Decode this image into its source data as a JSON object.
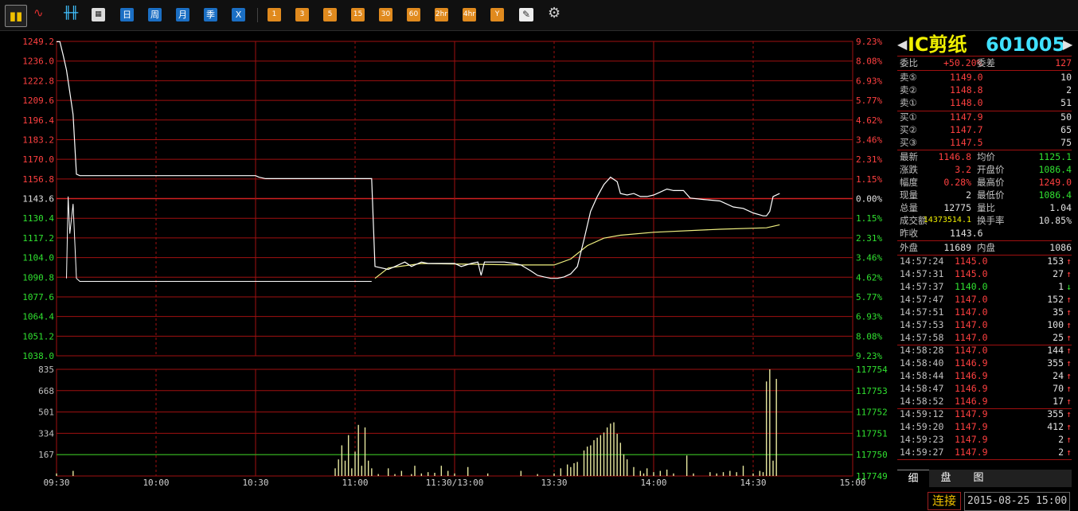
{
  "toolbar": {
    "buttons": [
      "日",
      "周",
      "月",
      "季",
      "X",
      "1",
      "3",
      "5",
      "15",
      "30",
      "60",
      "2hr",
      "4hr",
      "Y"
    ]
  },
  "stock": {
    "name": "IC剪纸",
    "code": "601005"
  },
  "order_book": {
    "weibi_label": "委比",
    "weibi_value": "+50.20%",
    "weicha_label": "委差",
    "weicha_value": "127",
    "asks": [
      {
        "label": "卖⑤",
        "price": "1149.0",
        "volume": "10"
      },
      {
        "label": "卖②",
        "price": "1148.8",
        "volume": "2"
      },
      {
        "label": "卖①",
        "price": "1148.0",
        "volume": "51"
      }
    ],
    "bids": [
      {
        "label": "买①",
        "price": "1147.9",
        "volume": "50"
      },
      {
        "label": "买②",
        "price": "1147.7",
        "volume": "65"
      },
      {
        "label": "买③",
        "price": "1147.5",
        "volume": "75"
      }
    ]
  },
  "quote": {
    "rows": [
      {
        "l1": "最新",
        "v1": "1146.8",
        "c1": "r",
        "l2": "均价",
        "v2": "1125.1",
        "c2": "g"
      },
      {
        "l1": "涨跌",
        "v1": "3.2",
        "c1": "r",
        "l2": "开盘价",
        "v2": "1086.4",
        "c2": "g"
      },
      {
        "l1": "幅度",
        "v1": "0.28%",
        "c1": "r",
        "l2": "最高价",
        "v2": "1249.0",
        "c2": "r"
      },
      {
        "l1": "现量",
        "v1": "2",
        "c1": "w",
        "l2": "最低价",
        "v2": "1086.4",
        "c2": "g"
      },
      {
        "l1": "总量",
        "v1": "12775",
        "c1": "w",
        "l2": "量比",
        "v2": "1.04",
        "c2": "w"
      },
      {
        "l1": "成交额",
        "v1": "14373514.1",
        "c1": "y",
        "l2": "换手率",
        "v2": "10.85%",
        "c2": "w"
      }
    ],
    "prev_close_label": "昨收",
    "prev_close": "1143.6",
    "outer_label": "外盘",
    "outer": "11689",
    "inner_label": "内盘",
    "inner": "1086"
  },
  "trades": [
    {
      "time": "14:57:24",
      "price": "1145.0",
      "vol": "153",
      "dir": "↑",
      "pc": "r"
    },
    {
      "time": "14:57:31",
      "price": "1145.0",
      "vol": "27",
      "dir": "↑",
      "pc": "r"
    },
    {
      "time": "14:57:37",
      "price": "1140.0",
      "vol": "1",
      "dir": "↓",
      "pc": "g"
    },
    {
      "time": "14:57:47",
      "price": "1147.0",
      "vol": "152",
      "dir": "↑",
      "pc": "r"
    },
    {
      "time": "14:57:51",
      "price": "1147.0",
      "vol": "35",
      "dir": "↑",
      "pc": "r"
    },
    {
      "time": "14:57:53",
      "price": "1147.0",
      "vol": "100",
      "dir": "↑",
      "pc": "r"
    },
    {
      "time": "14:57:58",
      "price": "1147.0",
      "vol": "25",
      "dir": "↑",
      "pc": "r"
    },
    {
      "time": "14:58:28",
      "price": "1147.0",
      "vol": "144",
      "dir": "↑",
      "pc": "r"
    },
    {
      "time": "14:58:40",
      "price": "1146.9",
      "vol": "355",
      "dir": "↑",
      "pc": "r"
    },
    {
      "time": "14:58:44",
      "price": "1146.9",
      "vol": "24",
      "dir": "↑",
      "pc": "r"
    },
    {
      "time": "14:58:47",
      "price": "1146.9",
      "vol": "70",
      "dir": "↑",
      "pc": "r"
    },
    {
      "time": "14:58:52",
      "price": "1146.9",
      "vol": "17",
      "dir": "↑",
      "pc": "r"
    },
    {
      "time": "14:59:12",
      "price": "1147.9",
      "vol": "355",
      "dir": "↑",
      "pc": "r"
    },
    {
      "time": "14:59:20",
      "price": "1147.9",
      "vol": "412",
      "dir": "↑",
      "pc": "r"
    },
    {
      "time": "14:59:23",
      "price": "1147.9",
      "vol": "2",
      "dir": "↑",
      "pc": "r"
    },
    {
      "time": "14:59:27",
      "price": "1147.9",
      "vol": "2",
      "dir": "↑",
      "pc": "r"
    }
  ],
  "tabs": [
    "细",
    "盘",
    "图"
  ],
  "status": {
    "connection": "连接",
    "datetime": "2015-08-25 15:00"
  },
  "colors": {
    "up": "#ff4040",
    "down": "#30e030",
    "grid": "#a01010",
    "price_line": "#ffffff",
    "avg_line": "#f0f080",
    "volume_ref": "#20c020"
  },
  "chart_data": {
    "type": "line",
    "prev_close": 1143.6,
    "price_ticks": [
      "1249.2",
      "1236.0",
      "1222.8",
      "1209.6",
      "1196.4",
      "1183.2",
      "1170.0",
      "1156.8",
      "1143.6",
      "1130.4",
      "1117.2",
      "1104.0",
      "1090.8",
      "1077.6",
      "1064.4",
      "1051.2",
      "1038.0"
    ],
    "pct_ticks": [
      "9.23%",
      "8.08%",
      "6.93%",
      "5.77%",
      "4.62%",
      "3.46%",
      "2.31%",
      "1.15%",
      "0.00%",
      "1.15%",
      "2.31%",
      "3.46%",
      "4.62%",
      "5.77%",
      "6.93%",
      "8.08%",
      "9.23%"
    ],
    "ylim": [
      1038.0,
      1249.2
    ],
    "time_labels": [
      "09:30",
      "10:00",
      "10:30",
      "11:00",
      "11:30/13:00",
      "13:30",
      "14:00",
      "14:30",
      "15:00"
    ],
    "volume_ticks": [
      "835",
      "668",
      "501",
      "334",
      "167"
    ],
    "volume_right_ticks": [
      "117754",
      "117753",
      "117752",
      "117751",
      "117750",
      "117749"
    ],
    "volume_ylim": [
      0,
      835
    ],
    "volume_ref": 167,
    "price_series": {
      "name": "price",
      "points": [
        [
          0,
          1249
        ],
        [
          1,
          1249
        ],
        [
          2,
          1240
        ],
        [
          3,
          1230
        ],
        [
          4,
          1215
        ],
        [
          5,
          1200
        ],
        [
          6,
          1160
        ],
        [
          7,
          1159
        ],
        [
          20,
          1159
        ],
        [
          60,
          1159
        ],
        [
          61,
          1158
        ],
        [
          63,
          1157
        ],
        [
          95,
          1157
        ],
        [
          96,
          1098
        ],
        [
          100,
          1096
        ],
        [
          103,
          1099
        ],
        [
          105,
          1101
        ],
        [
          107,
          1098
        ],
        [
          110,
          1101
        ],
        [
          112,
          1100
        ],
        [
          118,
          1100
        ],
        [
          120,
          1100
        ],
        [
          122,
          1098
        ],
        [
          125,
          1100
        ],
        [
          127,
          1101
        ],
        [
          128,
          1092
        ],
        [
          129,
          1101
        ],
        [
          132,
          1101
        ],
        [
          135,
          1101
        ],
        [
          138,
          1100
        ],
        [
          140,
          1099
        ],
        [
          143,
          1095
        ],
        [
          145,
          1092
        ],
        [
          147,
          1091
        ],
        [
          149,
          1090
        ],
        [
          151,
          1090
        ],
        [
          153,
          1091
        ],
        [
          155,
          1093
        ],
        [
          157,
          1098
        ],
        [
          159,
          1116
        ],
        [
          161,
          1135
        ],
        [
          163,
          1145
        ],
        [
          165,
          1153
        ],
        [
          167,
          1158
        ],
        [
          169,
          1155
        ],
        [
          170,
          1147
        ],
        [
          172,
          1146
        ],
        [
          174,
          1147
        ],
        [
          176,
          1145
        ],
        [
          178,
          1145
        ],
        [
          180,
          1146
        ],
        [
          182,
          1148
        ],
        [
          184,
          1150
        ],
        [
          186,
          1149
        ],
        [
          189,
          1149
        ],
        [
          191,
          1144
        ],
        [
          195,
          1143
        ],
        [
          200,
          1142
        ],
        [
          204,
          1138
        ],
        [
          207,
          1137
        ],
        [
          210,
          1134
        ],
        [
          213,
          1132
        ],
        [
          214,
          1132
        ],
        [
          215,
          1135
        ],
        [
          216,
          1145
        ],
        [
          218,
          1147
        ]
      ]
    },
    "avg_series": {
      "name": "avg",
      "points": [
        [
          96,
          1090
        ],
        [
          100,
          1097
        ],
        [
          110,
          1100
        ],
        [
          140,
          1099
        ],
        [
          150,
          1099
        ],
        [
          155,
          1103
        ],
        [
          160,
          1112
        ],
        [
          165,
          1117
        ],
        [
          170,
          1119
        ],
        [
          180,
          1121
        ],
        [
          200,
          1123
        ],
        [
          214,
          1124
        ],
        [
          218,
          1126
        ]
      ]
    },
    "low_series": {
      "points": [
        [
          3,
          1090
        ],
        [
          3.5,
          1145
        ],
        [
          4,
          1120
        ],
        [
          5,
          1140
        ],
        [
          6,
          1090
        ],
        [
          7,
          1088
        ],
        [
          20,
          1088
        ],
        [
          60,
          1088
        ],
        [
          95,
          1088
        ]
      ]
    },
    "volumes": [
      [
        0,
        20
      ],
      [
        5,
        40
      ],
      [
        84,
        60
      ],
      [
        85,
        130
      ],
      [
        86,
        240
      ],
      [
        87,
        120
      ],
      [
        88,
        320
      ],
      [
        89,
        60
      ],
      [
        90,
        190
      ],
      [
        91,
        400
      ],
      [
        92,
        80
      ],
      [
        93,
        380
      ],
      [
        94,
        120
      ],
      [
        95,
        60
      ],
      [
        97,
        15
      ],
      [
        100,
        60
      ],
      [
        102,
        15
      ],
      [
        104,
        40
      ],
      [
        107,
        15
      ],
      [
        108,
        80
      ],
      [
        110,
        20
      ],
      [
        112,
        30
      ],
      [
        114,
        25
      ],
      [
        116,
        80
      ],
      [
        118,
        40
      ],
      [
        120,
        20
      ],
      [
        124,
        70
      ],
      [
        130,
        20
      ],
      [
        140,
        40
      ],
      [
        145,
        15
      ],
      [
        150,
        20
      ],
      [
        152,
        60
      ],
      [
        154,
        90
      ],
      [
        155,
        70
      ],
      [
        156,
        100
      ],
      [
        157,
        110
      ],
      [
        159,
        200
      ],
      [
        160,
        230
      ],
      [
        161,
        240
      ],
      [
        162,
        280
      ],
      [
        163,
        300
      ],
      [
        164,
        320
      ],
      [
        165,
        340
      ],
      [
        166,
        380
      ],
      [
        167,
        410
      ],
      [
        168,
        420
      ],
      [
        169,
        330
      ],
      [
        170,
        260
      ],
      [
        171,
        170
      ],
      [
        172,
        130
      ],
      [
        174,
        70
      ],
      [
        176,
        40
      ],
      [
        177,
        20
      ],
      [
        178,
        60
      ],
      [
        180,
        30
      ],
      [
        182,
        40
      ],
      [
        184,
        50
      ],
      [
        186,
        20
      ],
      [
        190,
        160
      ],
      [
        192,
        20
      ],
      [
        197,
        30
      ],
      [
        199,
        20
      ],
      [
        201,
        30
      ],
      [
        203,
        40
      ],
      [
        205,
        30
      ],
      [
        207,
        80
      ],
      [
        210,
        20
      ],
      [
        212,
        40
      ],
      [
        213,
        30
      ],
      [
        214,
        740
      ],
      [
        215,
        835
      ],
      [
        216,
        120
      ],
      [
        217,
        760
      ]
    ]
  }
}
